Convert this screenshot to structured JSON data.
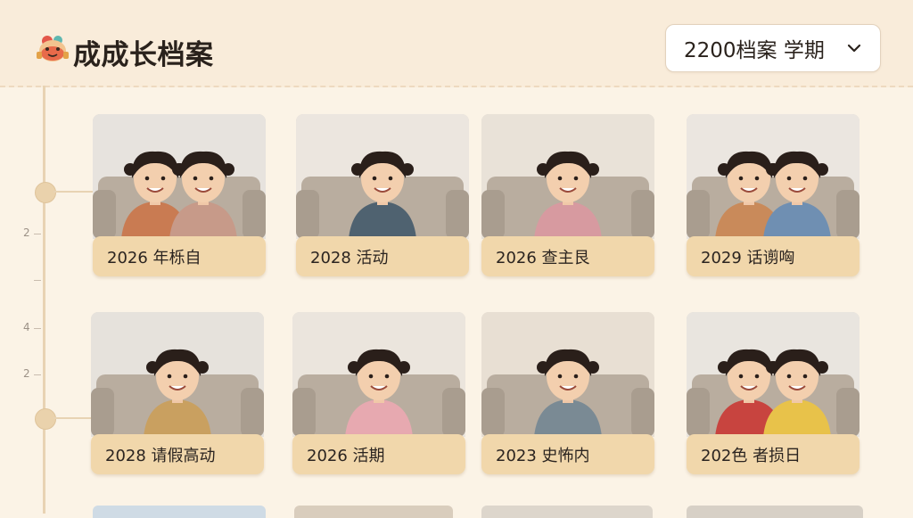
{
  "header": {
    "title": "成成长档案",
    "logo_icon": "cartoon-mascot-logo",
    "term_select": {
      "label": "2200档案 学期",
      "icon": "chevron-down-icon"
    }
  },
  "timeline": {
    "ruler_labels": [
      "2",
      "4",
      "2"
    ]
  },
  "albums": [
    {
      "label": "2026 年栎自",
      "kids": 2
    },
    {
      "label": "2028 活动",
      "kids": 1
    },
    {
      "label": "2026 查主艮",
      "kids": 1
    },
    {
      "label": "2029 话谫哅",
      "kids": 2
    },
    {
      "label": "2028 请假高动",
      "kids": 1
    },
    {
      "label": "2026 活期",
      "kids": 1
    },
    {
      "label": "2023 史怖内",
      "kids": 1
    },
    {
      "label": "202色 者损日",
      "kids": 2
    }
  ],
  "colors": {
    "background": "#fbf3e6",
    "header": "#f9ecda",
    "label_bar": "#f1d7ab",
    "timeline": "#e8d3b3"
  }
}
